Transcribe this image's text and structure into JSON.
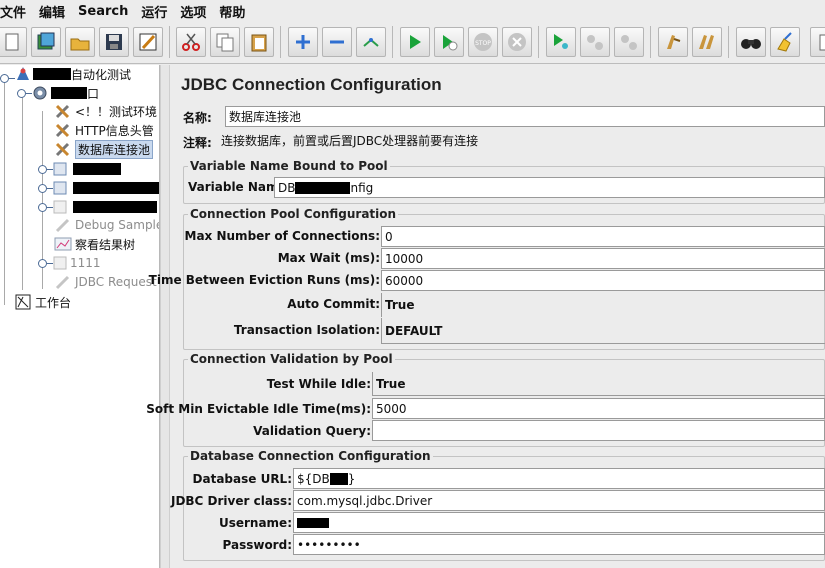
{
  "menu": [
    "文件",
    "编辑",
    "Search",
    "运行",
    "选项",
    "帮助"
  ],
  "toolbar_icons": [
    "new-icon",
    "templates-icon",
    "open-icon",
    "save-icon",
    "edit-icon",
    "cut-icon",
    "copy-icon",
    "paste-icon",
    "expand-icon",
    "collapse-icon",
    "toggle-icon",
    "start-icon",
    "start-no-pause-icon",
    "stop-icon",
    "shutdown-icon",
    "remote-start-icon",
    "remote-stop-icon",
    "remote-shutdown-icon",
    "clear-icon",
    "clear-all-icon",
    "search-icon",
    "reset-search-icon",
    "function-helper-icon"
  ],
  "tree": {
    "root_label": "自动化测试",
    "thread_group_suffix": "口",
    "items": [
      {
        "label": "<！！测试环境",
        "type": "config"
      },
      {
        "label": "HTTP信息头管",
        "type": "config"
      },
      {
        "label": "数据库连接池",
        "type": "config",
        "selected": true
      },
      {
        "label": "",
        "type": "controller"
      },
      {
        "label": "",
        "type": "controller"
      },
      {
        "label": "",
        "type": "controller-disabled"
      },
      {
        "label": "Debug Sample",
        "type": "sampler-disabled"
      },
      {
        "label": "察看结果树",
        "type": "listener"
      },
      {
        "label": "1111",
        "type": "controller-disabled"
      },
      {
        "label": "JDBC Request",
        "type": "sampler-disabled"
      }
    ],
    "workbench_label": "工作台"
  },
  "panel": {
    "title": "JDBC Connection Configuration",
    "name_label": "名称:",
    "name_value": "数据库连接池",
    "comment_label": "注释:",
    "comment_value": "连接数据库，前置或后置JDBC处理器前要有连接",
    "var_group": {
      "title": "Variable Name Bound to Pool",
      "var_label": "Variable Name:",
      "var_value_prefix": "DB",
      "var_value_suffix": "nfig"
    },
    "pool_group": {
      "title": "Connection Pool Configuration",
      "rows": [
        {
          "label": "Max Number of Connections:",
          "value": "0",
          "kind": "field"
        },
        {
          "label": "Max Wait (ms):",
          "value": "10000",
          "kind": "field"
        },
        {
          "label": "Time Between Eviction Runs (ms):",
          "value": "60000",
          "kind": "field"
        },
        {
          "label": "Auto Commit:",
          "value": "True",
          "kind": "combo"
        },
        {
          "label": "Transaction Isolation:",
          "value": "DEFAULT",
          "kind": "combo"
        }
      ]
    },
    "validation_group": {
      "title": "Connection Validation by Pool",
      "rows": [
        {
          "label": "Test While Idle:",
          "value": "True",
          "kind": "combo"
        },
        {
          "label": "Soft Min Evictable Idle Time(ms):",
          "value": "5000",
          "kind": "field"
        },
        {
          "label": "Validation Query:",
          "value": "",
          "kind": "field"
        }
      ]
    },
    "db_group": {
      "title": "Database Connection Configuration",
      "url_label": "Database URL:",
      "url_prefix": "${DB",
      "url_suffix": "}",
      "driver_label": "JDBC Driver class:",
      "driver_value": "com.mysql.jdbc.Driver",
      "user_label": "Username:",
      "password_label": "Password:",
      "password_value": "•••••••••"
    }
  },
  "colors": {
    "selection": "#c9d9ee",
    "accent_green": "#1aa33a",
    "accent_blue": "#2f6fd1"
  }
}
